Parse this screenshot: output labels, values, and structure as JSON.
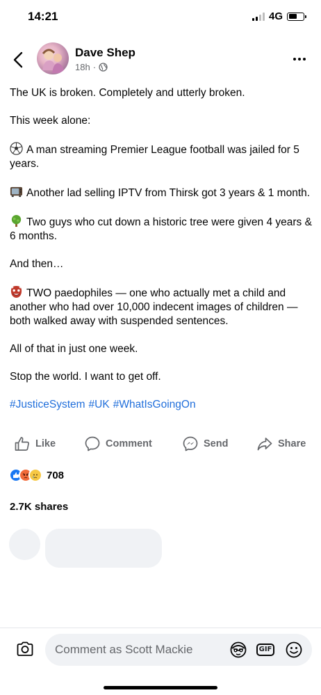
{
  "status_bar": {
    "time": "14:21",
    "network": "4G",
    "signal_bars": 4,
    "signal_active": 2,
    "battery_level": 0.58
  },
  "header": {
    "back_icon": "chevron-left-icon",
    "author_name": "Dave Shep",
    "timestamp": "18h",
    "separator": "·",
    "audience_icon": "globe-icon",
    "more_icon": "ellipsis-icon"
  },
  "post": {
    "paragraphs": [
      {
        "emoji": "",
        "text": "The UK is broken. Completely and utterly broken."
      },
      {
        "emoji": "",
        "text": "This week alone:"
      },
      {
        "emoji": "soccer-ball-icon",
        "text": "A man streaming Premier League football was jailed for 5 years."
      },
      {
        "emoji": "tv-icon",
        "text": "Another lad selling IPTV from Thirsk got 3 years & 1 month."
      },
      {
        "emoji": "tree-icon",
        "text": "Two guys who cut down a historic tree were given 4 years & 6 months."
      },
      {
        "emoji": "",
        "text": "And then…"
      },
      {
        "emoji": "ogre-icon",
        "text": "TWO paedophiles — one who actually met a child and another who had over 10,000 indecent images of children — both walked away with suspended sentences."
      },
      {
        "emoji": "",
        "text": "All of that in just one week."
      },
      {
        "emoji": "",
        "text": "Stop the world. I want to get off."
      }
    ],
    "hashtags": [
      "#JusticeSystem",
      "#UK",
      "#WhatIsGoingOn"
    ]
  },
  "actions": {
    "like": "Like",
    "comment": "Comment",
    "send": "Send",
    "share": "Share"
  },
  "reactions": {
    "types": [
      "like",
      "angry",
      "sad"
    ],
    "count": "708"
  },
  "shares": "2.7K shares",
  "composer": {
    "placeholder": "Comment as Scott Mackie",
    "icons": [
      "camera-icon",
      "avatar-sticker-icon",
      "gif-icon",
      "emoji-icon"
    ],
    "gif_label": "GIF"
  },
  "colors": {
    "link": "#216fdb",
    "secondary_text": "#65676b",
    "like_blue": "#1877f2",
    "angry_orange": "#f26b3a",
    "sad_yellow": "#f7c844",
    "skeleton": "#f0f2f5"
  }
}
